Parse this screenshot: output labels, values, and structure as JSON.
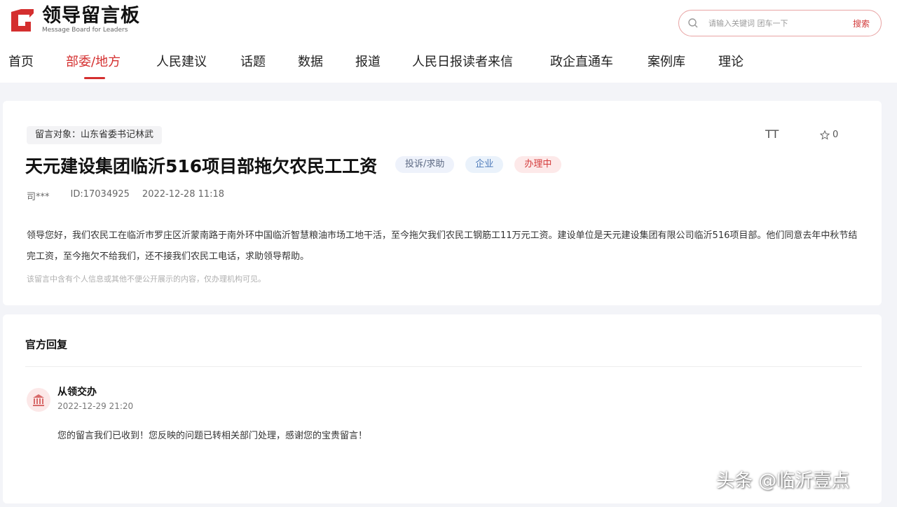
{
  "header": {
    "logo_cn": "领导留言板",
    "logo_en": "Message Board for Leaders",
    "search_placeholder": "请输入关键词 团车一下",
    "search_button": "搜索"
  },
  "nav": {
    "items": [
      "首页",
      "部委/地方",
      "人民建议",
      "话题",
      "数据",
      "报道",
      "人民日报读者来信",
      "政企直通车",
      "案例库",
      "理论"
    ],
    "active": "部委/地方"
  },
  "message": {
    "target_label": "留言对象：山东省委书记林武",
    "font_tool": "TT",
    "favorite_count": "0",
    "title": "天元建设集团临沂516项目部拖欠农民工工资",
    "tags": [
      "投诉/求助",
      "企业",
      "办理中"
    ],
    "author": "司***",
    "id": "ID:17034925",
    "time": "2022-12-28 11:18",
    "content": "领导您好，我们农民工在临沂市罗庄区沂蒙南路于南外环中国临沂智慧粮油市场工地干活，至今拖欠我们农民工钢筋工11万元工资。建设单位是天元建设集团有限公司临沂516项目部。他们同意去年中秋节结完工资，至今拖欠不给我们，还不接我们农民工电话，求助领导帮助。",
    "note": "该留言中含有个人信息或其他不便公开展示的内容，仅办理机构可见。"
  },
  "reply": {
    "section_title": "官方回复",
    "name": "从领交办",
    "time": "2022-12-29 21:20",
    "text": "您的留言我们已收到！您反映的问题已转相关部门处理，感谢您的宝贵留言！"
  },
  "watermark": "头条 @临沂壹点",
  "colors": {
    "accent": "#d42f2f",
    "background": "#f3f4f8"
  },
  "icons": [
    "logo-icon",
    "search-icon",
    "font-size-icon",
    "star-icon",
    "government-building-icon"
  ]
}
